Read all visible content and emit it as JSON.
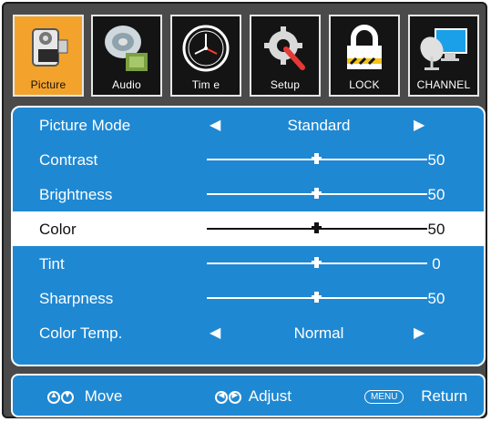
{
  "tabs": [
    {
      "label": "Picture",
      "icon": "camera-icon",
      "active": true
    },
    {
      "label": "Audio",
      "icon": "speaker-icon",
      "active": false
    },
    {
      "label": "Tim e",
      "icon": "clock-icon",
      "active": false
    },
    {
      "label": "Setup",
      "icon": "gear-wrench-icon",
      "active": false
    },
    {
      "label": "LOCK",
      "icon": "padlock-icon",
      "active": false
    },
    {
      "label": "CHANNEL",
      "icon": "satellite-monitor-icon",
      "active": false
    }
  ],
  "menu": {
    "rows": [
      {
        "name": "Picture Mode",
        "type": "choice",
        "value": "Standard"
      },
      {
        "name": "Contrast",
        "type": "slider",
        "value": "50",
        "level": 0.5
      },
      {
        "name": "Brightness",
        "type": "slider",
        "value": "50",
        "level": 0.5
      },
      {
        "name": "Color",
        "type": "slider",
        "value": "50",
        "level": 0.5,
        "selected": true
      },
      {
        "name": "Tint",
        "type": "slider",
        "value": "0",
        "level": 0.5
      },
      {
        "name": "Sharpness",
        "type": "slider",
        "value": "50",
        "level": 0.5
      },
      {
        "name": "Color Temp.",
        "type": "choice",
        "value": "Normal"
      }
    ]
  },
  "footer": {
    "move_label": "Move",
    "adjust_label": "Adjust",
    "menu_key": "MENU",
    "return_label": "Return"
  },
  "colors": {
    "panel_blue": "#1f88d2",
    "active_tab": "#f3a32b",
    "tab_bg": "#141414"
  }
}
